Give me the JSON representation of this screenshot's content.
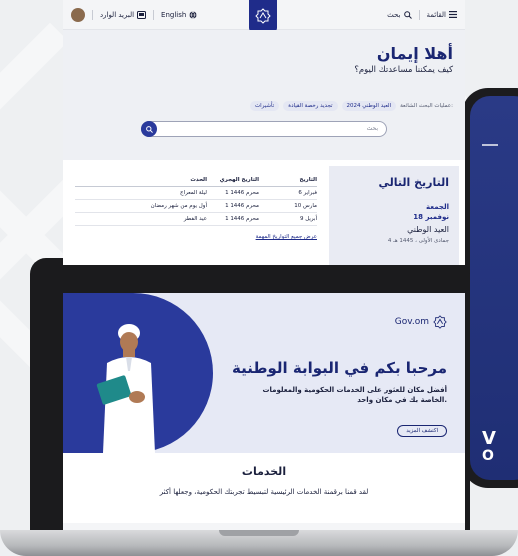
{
  "topbar": {
    "menu_label": "القائمة",
    "search_label": "بحث",
    "language_label": "English",
    "mail_label": "البريد الوارد"
  },
  "hero": {
    "title": "أهلا إيمان",
    "subtitle": "كيف يمكننا مساعدتك اليوم؟",
    "popular_label": "عمليات البحث الشائعة:",
    "chips": [
      "العيد الوطني 2024",
      "تجديد رخصة القيادة",
      "تأشيرات"
    ],
    "search_placeholder": "بحث"
  },
  "events": {
    "headers": [
      "التاريخ",
      "التاريخ الهجري",
      "الحدث"
    ],
    "rows": [
      [
        "6 فبراير",
        "1 محرم 1446",
        "ليلة المعراج"
      ],
      [
        "10 مارس",
        "1 محرم 1446",
        "أول يوم من شهر رمضان"
      ],
      [
        "9 أبريل",
        "1 محرم 1446",
        "عيد الفطر"
      ]
    ],
    "link": "عرض جميع التواريخ المهمة"
  },
  "next_date": {
    "title": "التاريخ التالي",
    "day": "الجمعة",
    "date": "18 نوفمبر",
    "name": "العيد الوطني",
    "hijri": "4 جمادى الأولى ، 1445 هـ"
  },
  "promo": {
    "logo_text": "Gov.om",
    "title": "مرحبا بكم في البوابة الوطنية",
    "description": "أفضل مكان للعثور على الخدمات الحكومية والمعلومات الخاصة بك في مكان واحد.",
    "button_label": "اكتشف المزيد"
  },
  "services": {
    "title": "الخدمات",
    "description": "لقد قمنا برقمنة الخدمات الرئيسية لتبسيط تجربتك الحكومية، وجعلها أكثر"
  },
  "colors": {
    "brand_navy": "#1a2672",
    "brand_blue": "#2a3a9c",
    "hero_bg": "#eef0f4"
  },
  "icons": [
    "hamburger-icon",
    "search-icon",
    "globe-icon",
    "mail-icon",
    "avatar",
    "gov-logo-icon"
  ]
}
